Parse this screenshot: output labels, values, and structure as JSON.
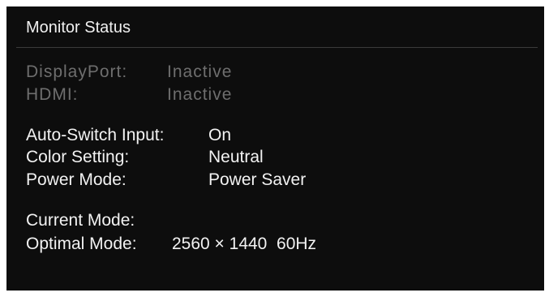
{
  "panel": {
    "title": "Monitor Status"
  },
  "inputs": [
    {
      "label": "DisplayPort:",
      "value": "Inactive"
    },
    {
      "label": "HDMI:",
      "value": "Inactive"
    }
  ],
  "settings": [
    {
      "label": "Auto-Switch Input:",
      "value": "On"
    },
    {
      "label": "Color Setting:",
      "value": "Neutral"
    },
    {
      "label": "Power Mode:",
      "value": "Power Saver"
    }
  ],
  "modes": {
    "current_label": "Current Mode:",
    "current_value": "",
    "optimal_label": "Optimal Mode:",
    "optimal_value": "2560 × 1440  60Hz"
  },
  "colors": {
    "background": "#0d0d0d",
    "text": "#f2f2f2",
    "inactive_text": "#6e6e6e"
  }
}
